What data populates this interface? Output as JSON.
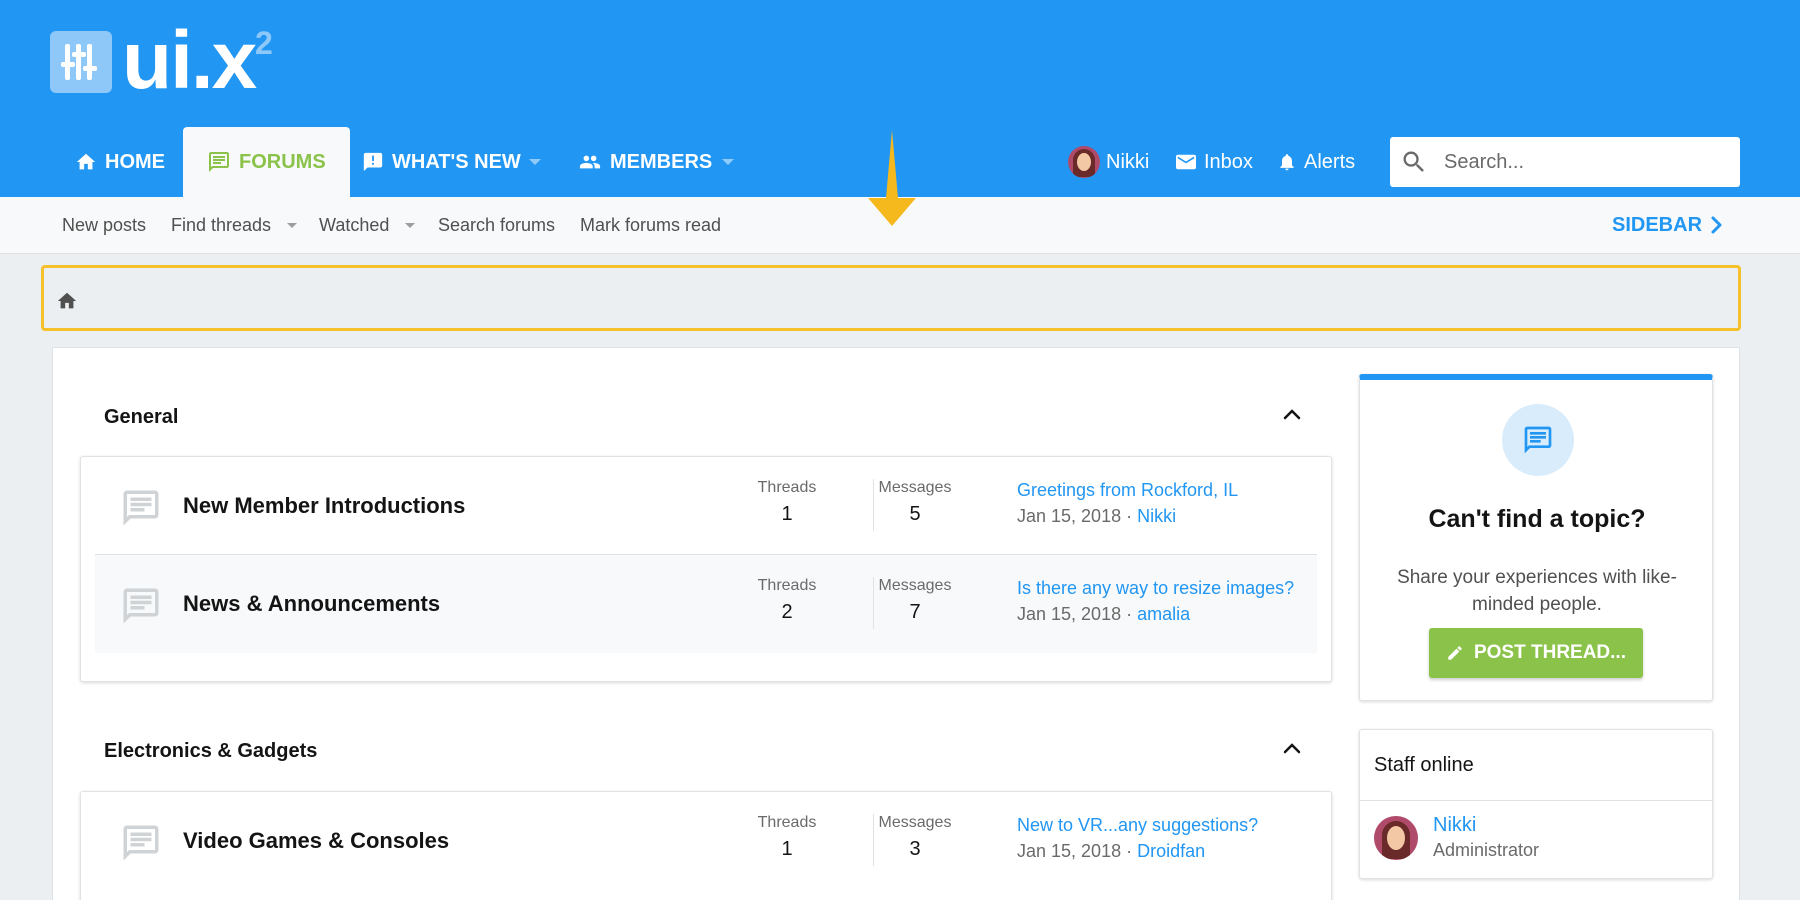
{
  "brand": {
    "logo_text": "ui.x",
    "logo_sup": "2"
  },
  "nav": {
    "tabs": [
      {
        "label": "HOME",
        "icon": "home-icon"
      },
      {
        "label": "FORUMS",
        "icon": "forum-chat-icon",
        "active": true
      },
      {
        "label": "WHAT'S NEW",
        "icon": "alert-message-icon"
      },
      {
        "label": "MEMBERS",
        "icon": "members-icon"
      }
    ],
    "user": {
      "name": "Nikki",
      "inbox": "Inbox",
      "alerts": "Alerts"
    },
    "search_placeholder": "Search..."
  },
  "subnav": {
    "items": [
      "New posts",
      "Find threads",
      "Watched",
      "Search forums",
      "Mark forums read"
    ],
    "sidebar_label": "SIDEBAR"
  },
  "categories": [
    {
      "title": "General",
      "nodes": [
        {
          "title": "New Member Introductions",
          "threads_label": "Threads",
          "threads": "1",
          "messages_label": "Messages",
          "messages": "5",
          "latest_title": "Greetings from Rockford, IL",
          "latest_date": "Jan 15, 2018 ·",
          "latest_user": "Nikki"
        },
        {
          "title": "News & Announcements",
          "threads_label": "Threads",
          "threads": "2",
          "messages_label": "Messages",
          "messages": "7",
          "latest_title": "Is there any way to resize images?",
          "latest_date": "Jan 15, 2018 ·",
          "latest_user": "amalia"
        }
      ]
    },
    {
      "title": "Electronics & Gadgets",
      "nodes": [
        {
          "title": "Video Games & Consoles",
          "threads_label": "Threads",
          "threads": "1",
          "messages_label": "Messages",
          "messages": "3",
          "latest_title": "New to VR...any suggestions?",
          "latest_date": "Jan 15, 2018 ·",
          "latest_user": "Droidfan"
        }
      ]
    }
  ],
  "sidebar": {
    "cta_title": "Can't find a topic?",
    "cta_desc": "Share your experiences with like-minded people.",
    "cta_button": "POST THREAD...",
    "staff_title": "Staff online",
    "staff": [
      {
        "name": "Nikki",
        "role": "Administrator"
      }
    ]
  },
  "colors": {
    "primary": "#2196f3",
    "accent": "#8bc34a",
    "highlight": "#f5c02a"
  }
}
